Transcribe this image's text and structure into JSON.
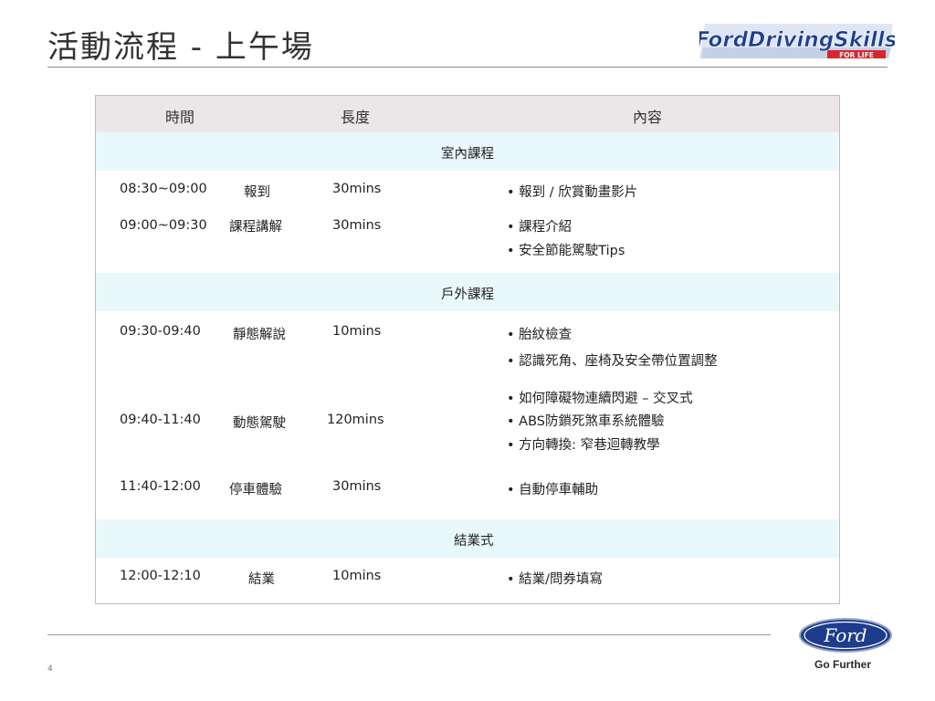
{
  "slide": {
    "title": "活動流程 - 上午場",
    "page_number": "4"
  },
  "brand": {
    "logo_line1": "FordDrivingSkills",
    "logo_line2": "FOR LIFE",
    "oval_text": "Ford",
    "tagline": "Go Further",
    "colors": {
      "navy": "#1f3f8f",
      "red": "#d8262e",
      "oval_blue": "#1e3c8c"
    }
  },
  "table": {
    "headers": {
      "time": "時間",
      "length": "長度",
      "content": "內容"
    },
    "sections": {
      "indoor": "室內課程",
      "outdoor": "戶外課程",
      "closing": "結業式"
    },
    "rows": [
      {
        "time": "08:30~09:00",
        "activity": "報到",
        "length": "30mins",
        "content": [
          "報到 / 欣賞動畫影片"
        ]
      },
      {
        "time": "09:00~09:30",
        "activity": "課程講解",
        "length": "30mins",
        "content": [
          "課程介紹",
          "安全節能駕駛Tips"
        ]
      },
      {
        "time": "09:30-09:40",
        "activity": "靜態解說",
        "length": "10mins",
        "content": [
          "胎紋檢查",
          "認識死角、座椅及安全帶位置調整"
        ]
      },
      {
        "time": "09:40-11:40",
        "activity": "動態駕駛",
        "length": "120mins",
        "content": [
          "如何障礙物連續閃避 – 交叉式",
          "ABS防鎖死煞車系統體驗",
          "方向轉換: 窄巷迴轉教學"
        ]
      },
      {
        "time": "11:40-12:00",
        "activity": "停車體驗",
        "length": "30mins",
        "content": [
          "自動停車輔助"
        ]
      },
      {
        "time": "12:00-12:10",
        "activity": "結業",
        "length": "10mins",
        "content": [
          "結業/問券填寫"
        ]
      }
    ]
  }
}
